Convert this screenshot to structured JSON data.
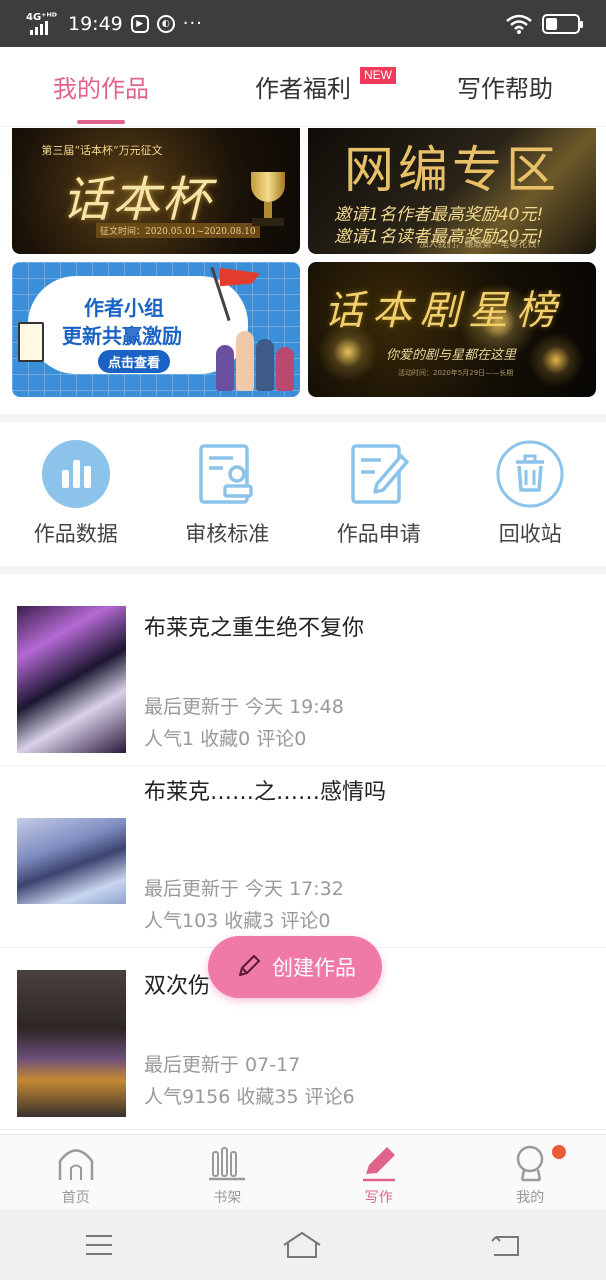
{
  "status": {
    "network": "4G⁺ᴴᴰ",
    "time": "19:49",
    "more": "···"
  },
  "tabs": [
    {
      "label": "我的作品",
      "active": true
    },
    {
      "label": "作者福利",
      "badge": "NEW"
    },
    {
      "label": "写作帮助"
    }
  ],
  "banners": {
    "b1": {
      "small": "第三届“话本杯”万元征文",
      "big": "话本杯",
      "date": "征文时间：2020.05.01~2020.08.10"
    },
    "b2": {
      "big": "网编专区",
      "line1": "邀请1名作者最高奖励40元!",
      "line2": "邀请1名读者最高奖励20元!",
      "foot": "加入我们，赚取第一笔零花钱!"
    },
    "b3": {
      "line1": "作者小组",
      "line2": "更新共赢激励",
      "cta": "点击查看"
    },
    "b4": {
      "big": "话本剧星榜",
      "sub": "你爱的剧与星都在这里",
      "foot": "活动时间：2020年5月29日——长期"
    }
  },
  "actions": [
    {
      "label": "作品数据",
      "icon": "bar-chart-icon"
    },
    {
      "label": "审核标准",
      "icon": "review-stamp-icon"
    },
    {
      "label": "作品申请",
      "icon": "edit-document-icon"
    },
    {
      "label": "回收站",
      "icon": "trash-icon"
    }
  ],
  "works": [
    {
      "title": "布莱克之重生绝不复你",
      "updated": "最后更新于 今天 19:48",
      "stats": "人气1 收藏0 评论0"
    },
    {
      "title": "布莱克……之……感情吗",
      "updated": "最后更新于 今天 17:32",
      "stats": "人气103 收藏3 评论0"
    },
    {
      "title": "双次伤",
      "updated": "最后更新于 07-17",
      "stats": "人气9156 收藏35 评论6"
    }
  ],
  "create_button": "创建作品",
  "bottom_nav": [
    {
      "label": "首页",
      "icon": "home-icon"
    },
    {
      "label": "书架",
      "icon": "bookshelf-icon"
    },
    {
      "label": "写作",
      "icon": "pen-icon",
      "active": true
    },
    {
      "label": "我的",
      "icon": "profile-icon"
    }
  ],
  "colors": {
    "accent": "#e0648a",
    "create_button": "#f07aa7",
    "icon_blue": "#8cc3ea"
  }
}
